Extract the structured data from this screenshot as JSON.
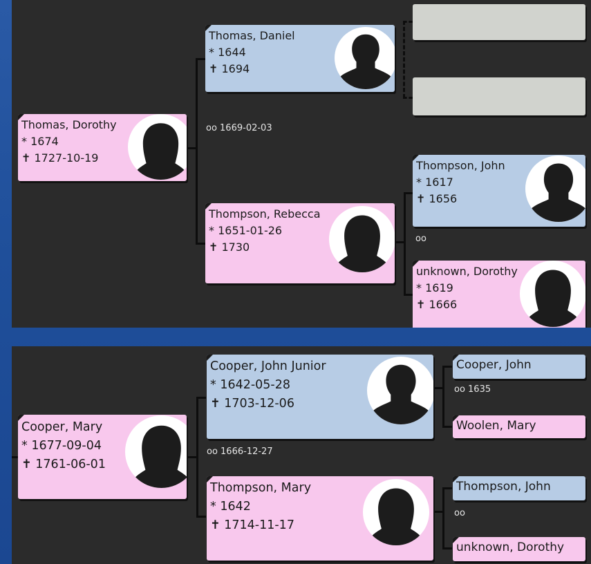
{
  "panel1": {
    "root": {
      "name": "Thomas, Dorothy",
      "birth": "* 1674",
      "death": "1727-10-19"
    },
    "father": {
      "name": "Thomas, Daniel",
      "birth": "* 1644",
      "death": "1694"
    },
    "mother": {
      "name": "Thompson, Rebecca",
      "birth": "* 1651-01-26",
      "death": "1730"
    },
    "parents_marriage": "oo 1669-02-03",
    "mgf": {
      "name": "Thompson, John",
      "birth": "* 1617",
      "death": "1656"
    },
    "mgm": {
      "name": "unknown, Dorothy",
      "birth": "* 1619",
      "death": "1666"
    },
    "mgp_marriage": "oo",
    "death_symbol": "✝"
  },
  "panel2": {
    "root": {
      "name": "Cooper, Mary",
      "birth": "* 1677-09-04",
      "death": "1761-06-01"
    },
    "father": {
      "name": "Cooper, John Junior",
      "birth": "* 1642-05-28",
      "death": "1703-12-06"
    },
    "mother": {
      "name": "Thompson, Mary",
      "birth": "* 1642",
      "death": "1714-11-17"
    },
    "parents_marriage": "oo 1666-12-27",
    "pgf": {
      "name": "Cooper, John"
    },
    "pgm": {
      "name": "Woolen, Mary"
    },
    "pgp_marriage": "oo 1635",
    "mgf": {
      "name": "Thompson, John"
    },
    "mgm": {
      "name": "unknown, Dorothy"
    },
    "mgp_marriage": "oo",
    "death_symbol": "✝"
  }
}
